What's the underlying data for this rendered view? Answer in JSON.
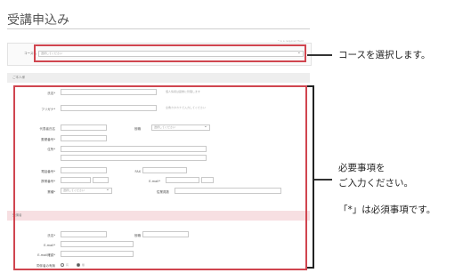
{
  "form": {
    "title": "受講申込み",
    "top_note": "* is a required field",
    "course_label": "コース名",
    "course_select": "選択してください"
  },
  "section1": {
    "title": "ご本人様",
    "fields": {
      "name": "氏名*",
      "kana": "フリガナ*",
      "rep": "代表者氏名",
      "position": "役職",
      "postal": "郵便番号*",
      "address": "住所*",
      "tel": "電話番号*",
      "fax": "FAX",
      "mobile": "携帯番号*",
      "email": "E-mail*",
      "industry": "業種*",
      "company_count": "従業員数"
    },
    "position_select": "選択してください",
    "industry_select": "選択してください",
    "name_note": "個人情報は厳重に管理します",
    "kana_note": "全角カタカナで入力してください"
  },
  "section2": {
    "title": "受講者",
    "fields": {
      "name": "氏名*",
      "position": "役職",
      "email": "E-mail*",
      "email_confirm": "E-mail確認*",
      "attendance": "同伴者の有無"
    },
    "radio_yes": "有",
    "radio_no": "無"
  },
  "annotations": {
    "course": "コースを選択します。",
    "required_line1": "必要事項を",
    "required_line2": "ご入力ください。",
    "required_note": "「*」は必須事項です。"
  },
  "colors": {
    "highlight": "#d0454f",
    "section_pink": "#f7dfe2",
    "section_gray": "#eeeeee"
  }
}
